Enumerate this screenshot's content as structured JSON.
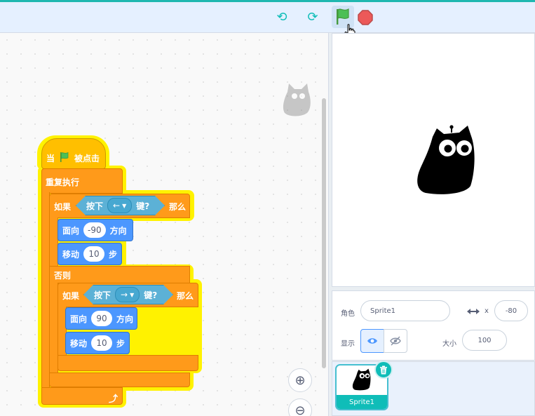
{
  "toolbar": {
    "turbo_icon": "refresh-icon",
    "loop_icon": "refresh-icon",
    "green_flag_icon": "green-flag-icon",
    "stop_icon": "stop-icon"
  },
  "script": {
    "hat_when": "当",
    "hat_clicked": "被点击",
    "forever": "重复执行",
    "if1": {
      "if": "如果",
      "key_pressed": "按下",
      "key": "←",
      "key_suffix": "键?",
      "then": "那么"
    },
    "point1": {
      "label": "面向",
      "value": "-90",
      "suffix": "方向"
    },
    "move1": {
      "label": "移动",
      "value": "10",
      "suffix": "步"
    },
    "else": "否则",
    "if2": {
      "if": "如果",
      "key_pressed": "按下",
      "key": "→",
      "key_suffix": "键?",
      "then": "那么"
    },
    "point2": {
      "label": "面向",
      "value": "90",
      "suffix": "方向"
    },
    "move2": {
      "label": "移动",
      "value": "10",
      "suffix": "步"
    },
    "loop_arrow": "⤴"
  },
  "sprite_info": {
    "sprite_label": "角色",
    "sprite_name": "Sprite1",
    "x_label": "x",
    "x_value": "-80",
    "show_label": "显示",
    "size_label": "大小",
    "size_value": "100"
  },
  "sprite_list": [
    {
      "name": "Sprite1",
      "selected": true
    }
  ],
  "colors": {
    "events": "#ffbf00",
    "control": "#ff9a1a",
    "motion": "#4c97ff",
    "sensing": "#5cb1d6",
    "glow": "#fff200",
    "accent": "#0fbdb8"
  }
}
